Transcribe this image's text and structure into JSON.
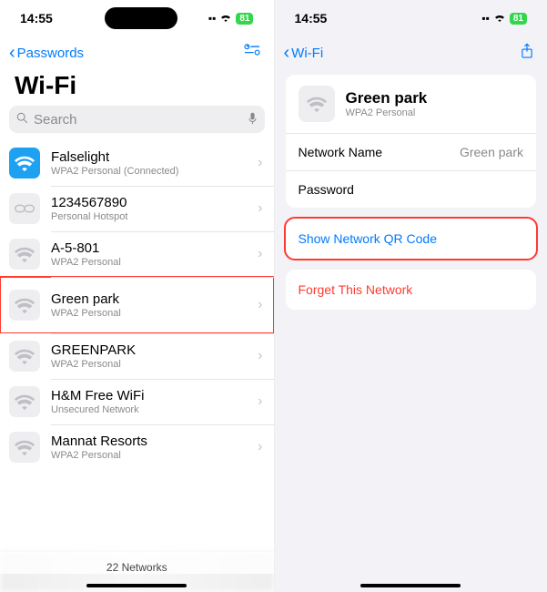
{
  "status": {
    "time": "14:55",
    "battery": "81"
  },
  "left": {
    "back_label": "Passwords",
    "title": "Wi-Fi",
    "search_placeholder": "Search",
    "networks": [
      {
        "name": "Falselight",
        "sub": "WPA2 Personal (Connected)",
        "icon": "wifi",
        "connected": true
      },
      {
        "name": "1234567890",
        "sub": "Personal Hotspot",
        "icon": "link"
      },
      {
        "name": "A-5-801",
        "sub": "WPA2 Personal",
        "icon": "wifi"
      },
      {
        "name": "Green park",
        "sub": "WPA2 Personal",
        "icon": "wifi",
        "highlight": true
      },
      {
        "name": "GREENPARK",
        "sub": "WPA2 Personal",
        "icon": "wifi"
      },
      {
        "name": "H&M Free WiFi",
        "sub": "Unsecured Network",
        "icon": "wifi"
      },
      {
        "name": "Mannat Resorts",
        "sub": "WPA2 Personal",
        "icon": "wifi"
      }
    ],
    "footer": "22 Networks"
  },
  "right": {
    "back_label": "Wi-Fi",
    "network": {
      "name": "Green park",
      "sub": "WPA2 Personal"
    },
    "fields": {
      "network_name_label": "Network Name",
      "network_name_value": "Green park",
      "password_label": "Password",
      "password_value": ""
    },
    "qr_label": "Show Network QR Code",
    "forget_label": "Forget This Network"
  }
}
